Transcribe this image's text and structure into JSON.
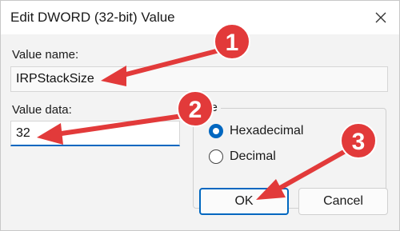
{
  "window": {
    "title": "Edit DWORD (32-bit) Value"
  },
  "value_name": {
    "label": "Value name:",
    "value": "IRPStackSize"
  },
  "value_data": {
    "label": "Value data:",
    "value": "32"
  },
  "base": {
    "legend": "se",
    "options": [
      {
        "label": "Hexadecimal",
        "selected": true
      },
      {
        "label": "Decimal",
        "selected": false
      }
    ]
  },
  "buttons": {
    "ok": "OK",
    "cancel": "Cancel"
  },
  "annotations": [
    {
      "number": "1"
    },
    {
      "number": "2"
    },
    {
      "number": "3"
    }
  ],
  "colors": {
    "accent": "#0067c0",
    "annotation": "#e23a3a"
  }
}
